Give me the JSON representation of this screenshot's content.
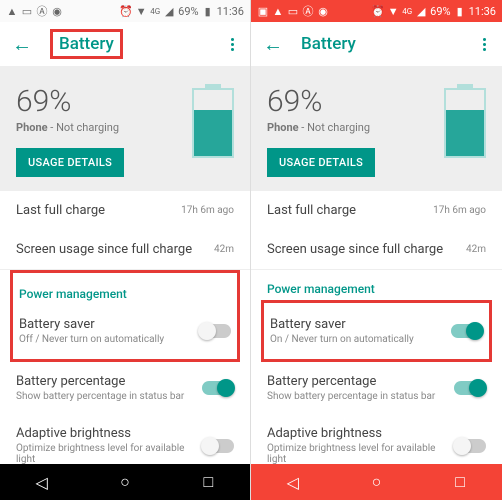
{
  "status": {
    "battery_pct": "69%",
    "time": "11:36",
    "net_ind": "4G"
  },
  "left": {
    "title": "Battery",
    "battery_percent": "69%",
    "phone_label": "Phone",
    "charge_state": "Not charging",
    "usage_btn": "USAGE DETAILS",
    "last_full_label": "Last full charge",
    "last_full_val": "17h 6m ago",
    "screen_usage_label": "Screen usage since full charge",
    "screen_usage_val": "42m",
    "power_mgmt": "Power management",
    "saver_label": "Battery saver",
    "saver_sub": "Off / Never turn on automatically",
    "saver_on": false,
    "pct_label": "Battery percentage",
    "pct_sub": "Show battery percentage in status bar",
    "adapt_label": "Adaptive brightness",
    "adapt_sub": "Optimize brightness level for available light"
  },
  "right": {
    "title": "Battery",
    "battery_percent": "69%",
    "phone_label": "Phone",
    "charge_state": "Not charging",
    "usage_btn": "USAGE DETAILS",
    "last_full_label": "Last full charge",
    "last_full_val": "17h 6m ago",
    "screen_usage_label": "Screen usage since full charge",
    "screen_usage_val": "42m",
    "power_mgmt": "Power management",
    "saver_label": "Battery saver",
    "saver_sub": "On / Never turn on automatically",
    "saver_on": true,
    "pct_label": "Battery percentage",
    "pct_sub": "Show battery percentage in status bar",
    "adapt_label": "Adaptive brightness",
    "adapt_sub": "Optimize brightness level for available light"
  }
}
